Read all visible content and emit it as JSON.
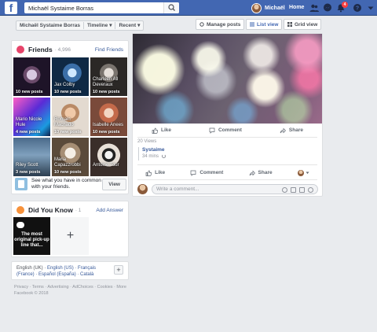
{
  "topbar": {
    "logo": "f",
    "search_value": "Michaël Systaime Borras",
    "user_name": "Michaël",
    "home_label": "Home",
    "notification_count": "4",
    "brand_color": "#4267b2"
  },
  "profile_nav": {
    "name": "Michaël Systaime Borras",
    "timeline_label": "Timeline",
    "recent_label": "Recent",
    "caret": "▾"
  },
  "view_controls": {
    "manage_posts": "Manage posts",
    "list_view": "List view",
    "grid_view": "Grid view"
  },
  "friends": {
    "title": "Friends",
    "count": "· 4,996",
    "find_link": "Find Friends",
    "tiles": [
      {
        "name": "",
        "posts": "10 new posts"
      },
      {
        "name": "Jax Colby",
        "posts": "10 new posts"
      },
      {
        "name": "Charleen All Deveraux",
        "posts": "10 new posts"
      },
      {
        "name": "Mario Nicole Hule",
        "posts": "4 new posts"
      },
      {
        "name": "Romain Machado",
        "posts": "10 new posts"
      },
      {
        "name": "Isabelle Anees",
        "posts": "10 new posts"
      },
      {
        "name": "Riley Scott",
        "posts": "3 new posts"
      },
      {
        "name": "Maria Capazzrobbi",
        "posts": "10 new posts"
      },
      {
        "name": "Antoine Tour",
        "posts": ""
      }
    ],
    "find_text": "See what you have in common with your friends.",
    "view_button": "View"
  },
  "did_you_know": {
    "title": "Did You Know",
    "count": "· 1",
    "add_answer": "Add Answer",
    "tile_text": "The most original pick-up line that...",
    "add_symbol": "+"
  },
  "languages": {
    "current": "English (UK)",
    "others": "English (US) · Français (France) · Español (España) · Català",
    "add_symbol": "+"
  },
  "footer": {
    "links": "Privacy · Terms · Advertising · AdChoices · Cookies · More",
    "copyright": "Facebook © 2018"
  },
  "post": {
    "like": "Like",
    "comment": "Comment",
    "share": "Share",
    "views": "20 Views",
    "tag_name": "Systaime",
    "tag_time": "34 mins",
    "comment_placeholder": "Write a comment..."
  }
}
